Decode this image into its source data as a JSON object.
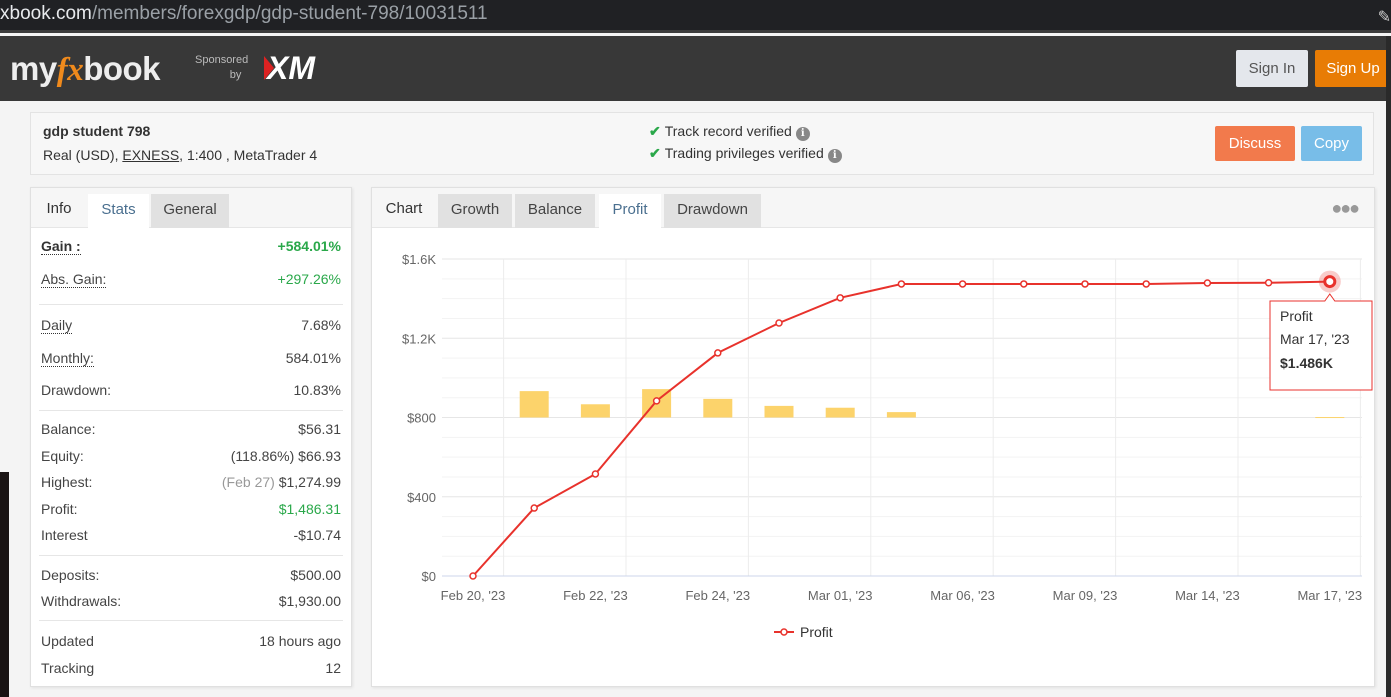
{
  "browser": {
    "url_host": "xbook.com",
    "url_path": "/members/forexgdp/gdp-student-798/10031511"
  },
  "header": {
    "logo_my": "my",
    "logo_fx": "fx",
    "logo_book": "book",
    "sponsored": "Sponsored",
    "by": "by",
    "sponsor_logo": "XM",
    "signin": "Sign In",
    "signup": "Sign Up"
  },
  "account": {
    "name": "gdp student 798",
    "type": "Real (USD),",
    "broker": "EXNESS",
    "details": ", 1:400 , MetaTrader 4",
    "verified": [
      "Track record verified",
      "Trading privileges verified"
    ],
    "discuss": "Discuss",
    "copy": "Copy"
  },
  "stats_tabs": [
    "Info",
    "Stats",
    "General"
  ],
  "stats": [
    {
      "k": "Gain :",
      "v": "+584.01%"
    },
    {
      "k": "Abs. Gain:",
      "v": "+297.26%"
    },
    {
      "k": "Daily",
      "v": "7.68%"
    },
    {
      "k": "Monthly:",
      "v": "584.01%"
    },
    {
      "k": "Drawdown:",
      "v": "10.83%"
    },
    {
      "k": "Balance:",
      "v": "$56.31"
    },
    {
      "k": "Equity:",
      "note": "(118.86%)",
      "v": "$66.93"
    },
    {
      "k": "Highest:",
      "note": "(Feb 27)",
      "v": "$1,274.99"
    },
    {
      "k": "Profit:",
      "v": "$1,486.31"
    },
    {
      "k": "Interest",
      "v": "-$10.74"
    },
    {
      "k": "Deposits:",
      "v": "$500.00"
    },
    {
      "k": "Withdrawals:",
      "v": "$1,930.00"
    },
    {
      "k": "Updated",
      "v": "18 hours ago"
    },
    {
      "k": "Tracking",
      "v": "12"
    }
  ],
  "chart_tabs": [
    "Chart",
    "Growth",
    "Balance",
    "Profit",
    "Drawdown"
  ],
  "colors": {
    "line": "#e8322c",
    "bars": "#fcd36b",
    "positive": "#2aa84a",
    "signup": "#e87c05",
    "discuss": "#f27a4c",
    "copy": "#78bde8"
  },
  "chart_data": {
    "type": "line",
    "y_tick_labels": [
      "$0",
      "$400",
      "$800",
      "$1.2K",
      "$1.6K"
    ],
    "ylim": [
      0,
      1600
    ],
    "x_tick_labels": [
      "Feb 20, '23",
      "Feb 22, '23",
      "Feb 24, '23",
      "Mar 01, '23",
      "Mar 06, '23",
      "Mar 09, '23",
      "Mar 14, '23",
      "Mar 17, '23"
    ],
    "series": [
      {
        "name": "Profit",
        "values": [
          0,
          343,
          515,
          884,
          1126,
          1277,
          1404,
          1474,
          1474,
          1474,
          1474,
          1474,
          1479,
          1480,
          1486
        ]
      }
    ],
    "bars": {
      "values": [
        0,
        343,
        172,
        369,
        242,
        151,
        127,
        70,
        0,
        0,
        0,
        0,
        0,
        0,
        6
      ]
    },
    "grid": true,
    "legend": "bottom",
    "tooltip": {
      "title": "Profit",
      "date": "Mar 17, '23",
      "value": "$1.486K"
    }
  }
}
